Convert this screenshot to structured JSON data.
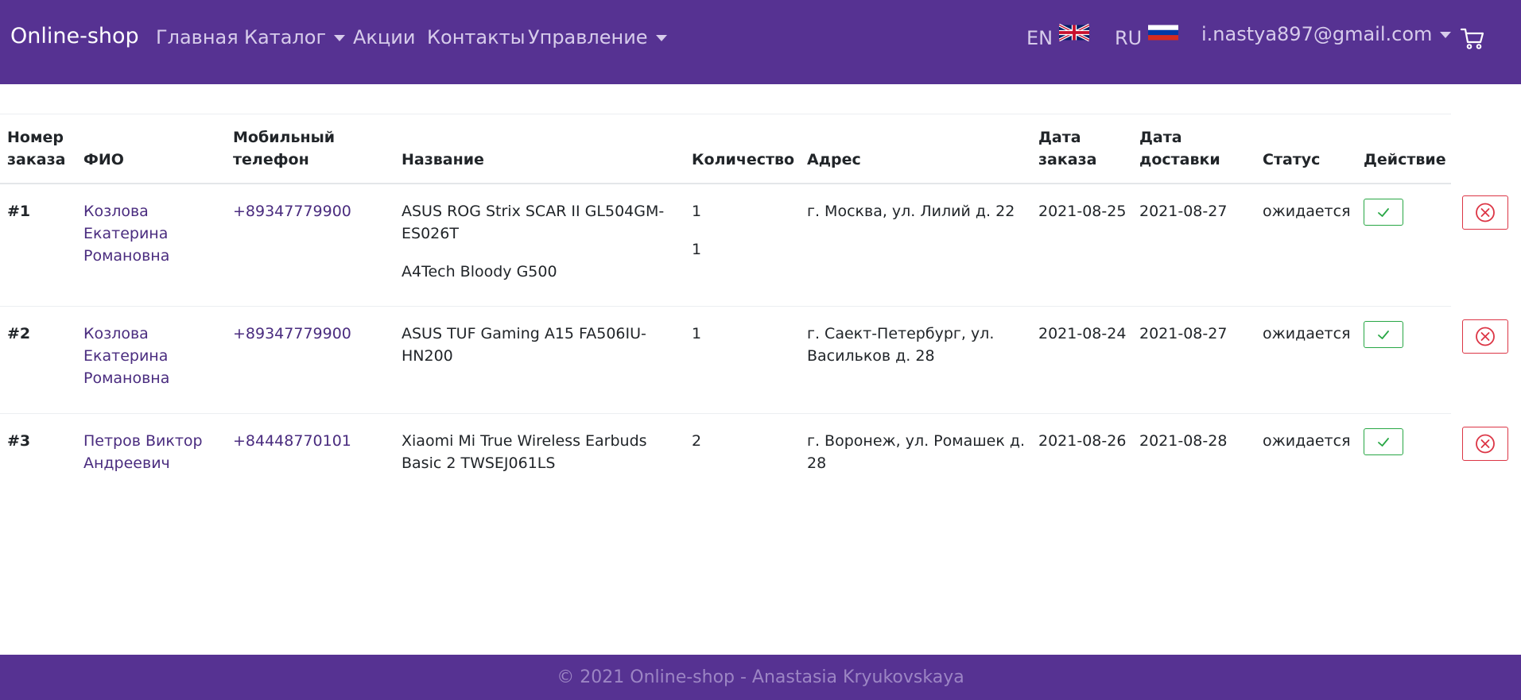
{
  "brand": "Online-shop",
  "nav": {
    "home": "Главная",
    "catalog": "Каталог",
    "promos": "Акции",
    "contacts": "Контакты",
    "manage": "Управление"
  },
  "lang": {
    "en": "EN",
    "ru": "RU"
  },
  "user": {
    "email": "i.nastya897@gmail.com"
  },
  "colors": {
    "navbar": "#563292",
    "success": "#28a745",
    "danger": "#dc3545",
    "link": "#4a2c7f"
  },
  "table": {
    "headers": {
      "number": [
        "Номер",
        "заказа"
      ],
      "name": "ФИО",
      "phone": [
        "Мобильный",
        "телефон"
      ],
      "title": "Название",
      "qty": "Количество",
      "address": "Адрес",
      "order_date": [
        "Дата",
        "заказа"
      ],
      "delivery_date": [
        "Дата",
        "доставки"
      ],
      "status": "Статус",
      "action": "Действие"
    },
    "rows": [
      {
        "number": "#1",
        "name": "Козлова Екатерина Романовна",
        "phone": "+89347779900",
        "items": [
          "ASUS ROG Strix SCAR II GL504GM-ES026T",
          "A4Tech Bloody G500"
        ],
        "qty": [
          "1",
          "1"
        ],
        "address": "г. Москва, ул. Лилий д. 22",
        "order_date": "2021-08-25",
        "delivery_date": "2021-08-27",
        "status": "ожидается"
      },
      {
        "number": "#2",
        "name": "Козлова Екатерина Романовна",
        "phone": "+89347779900",
        "items": [
          "ASUS TUF Gaming A15 FA506IU-HN200"
        ],
        "qty": [
          "1"
        ],
        "address": "г. Саект-Петербург, ул. Васильков д. 28",
        "order_date": "2021-08-24",
        "delivery_date": "2021-08-27",
        "status": "ожидается"
      },
      {
        "number": "#3",
        "name": "Петров Виктор Андреевич",
        "phone": "+84448770101",
        "items": [
          "Xiaomi Mi True Wireless Earbuds Basic 2 TWSEJ061LS"
        ],
        "qty": [
          "2"
        ],
        "address": "г. Воронеж, ул. Ромашек д. 28",
        "order_date": "2021-08-26",
        "delivery_date": "2021-08-28",
        "status": "ожидается"
      }
    ]
  },
  "icons": {
    "confirm": "check-icon",
    "delete": "circle-x-icon",
    "cart": "cart-icon"
  },
  "footer": "© 2021 Online-shop - Anastasia Kryukovskaya"
}
